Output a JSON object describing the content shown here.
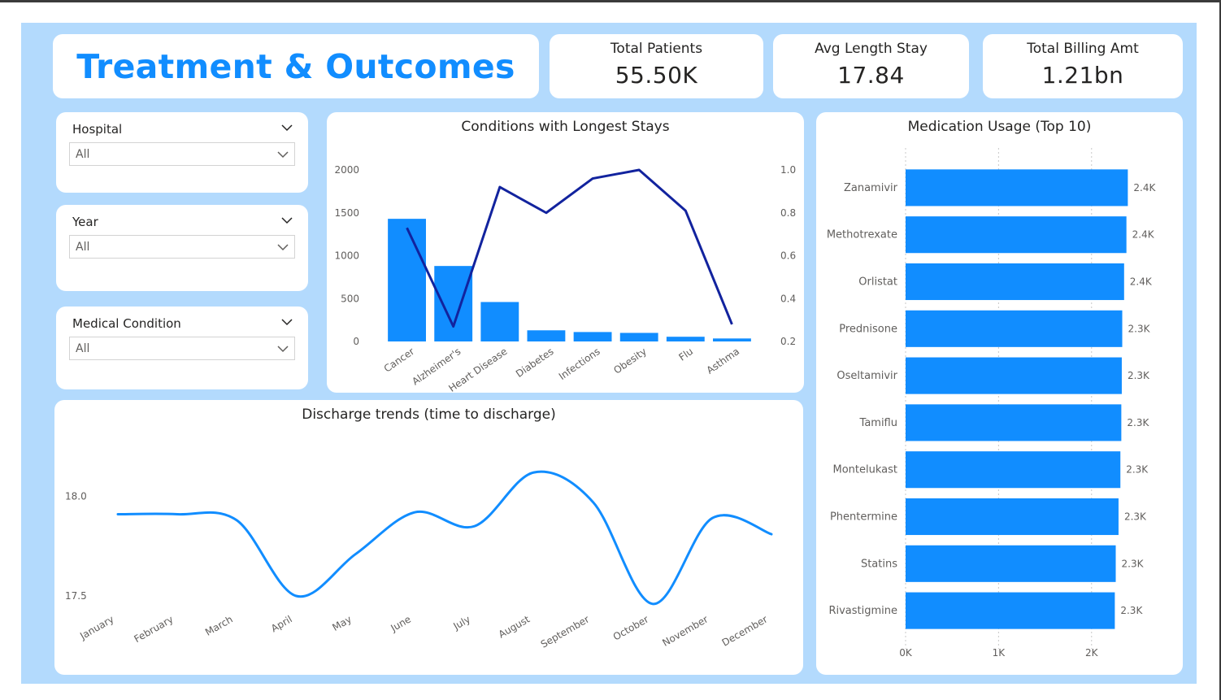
{
  "page": {
    "title": "Treatment & Outcomes"
  },
  "kpis": [
    {
      "label": "Total Patients",
      "value": "55.50K"
    },
    {
      "label": "Avg Length Stay",
      "value": "17.84"
    },
    {
      "label": "Total Billing Amt",
      "value": "1.21bn"
    }
  ],
  "slicers": [
    {
      "title": "Hospital",
      "value": "All"
    },
    {
      "title": "Year",
      "value": "All"
    },
    {
      "title": "Medical Condition",
      "value": "All"
    }
  ],
  "colors": {
    "background": "#b3dafd",
    "card": "#ffffff",
    "bar": "#118dff",
    "line_dark": "#12239e",
    "line_light": "#118dff",
    "title": "#118dff"
  },
  "chart_data": [
    {
      "id": "conditions",
      "type": "bar",
      "title": "Conditions with Longest Stays",
      "categories": [
        "Cancer",
        "Alzheimer's",
        "Heart Disease",
        "Diabetes",
        "Infections",
        "Obesity",
        "Flu",
        "Asthma"
      ],
      "series": [
        {
          "axis": "left",
          "type": "bar",
          "values": [
            1430,
            880,
            460,
            130,
            110,
            100,
            55,
            35
          ]
        },
        {
          "axis": "right",
          "type": "line",
          "values": [
            0.73,
            0.27,
            0.92,
            0.8,
            0.96,
            1.0,
            0.81,
            0.28
          ]
        }
      ],
      "yticks_left": [
        "0",
        "500",
        "1000",
        "1500",
        "2000"
      ],
      "yticks_right": [
        "0.2",
        "0.4",
        "0.6",
        "0.8",
        "1.0"
      ],
      "ylim_left": [
        0,
        2000
      ],
      "ylim_right": [
        0.2,
        1.0
      ]
    },
    {
      "id": "discharge",
      "type": "line",
      "title": "Discharge trends (time to discharge)",
      "categories": [
        "January",
        "February",
        "March",
        "April",
        "May",
        "June",
        "July",
        "August",
        "September",
        "October",
        "November",
        "December"
      ],
      "values": [
        17.91,
        17.91,
        17.88,
        17.5,
        17.71,
        17.92,
        17.85,
        18.12,
        17.97,
        17.46,
        17.89,
        17.81
      ],
      "yticks": [
        "17.5",
        "18.0"
      ],
      "ylim": [
        17.3,
        18.3
      ]
    },
    {
      "id": "medication",
      "type": "bar",
      "orientation": "horizontal",
      "title": "Medication Usage (Top 10)",
      "categories": [
        "Zanamivir",
        "Methotrexate",
        "Orlistat",
        "Prednisone",
        "Oseltamivir",
        "Tamiflu",
        "Montelukast",
        "Phentermine",
        "Statins",
        "Rivastigmine"
      ],
      "values": [
        2390,
        2375,
        2350,
        2330,
        2325,
        2320,
        2310,
        2290,
        2260,
        2250
      ],
      "data_labels": [
        "2.4K",
        "2.4K",
        "2.4K",
        "2.3K",
        "2.3K",
        "2.3K",
        "2.3K",
        "2.3K",
        "2.3K",
        "2.3K"
      ],
      "xticks": [
        "0K",
        "1K",
        "2K"
      ],
      "xlim": [
        0,
        2850
      ]
    }
  ]
}
